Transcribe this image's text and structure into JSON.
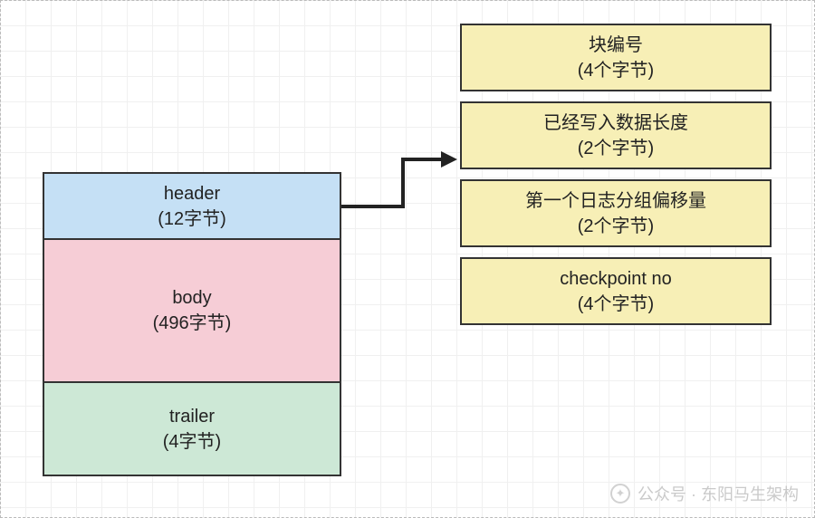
{
  "left_stack": {
    "header": {
      "label": "header",
      "sub": "(12字节)"
    },
    "body": {
      "label": "body",
      "sub": "(496字节)"
    },
    "trailer": {
      "label": "trailer",
      "sub": "(4字节)"
    }
  },
  "right_stack": {
    "block_no": {
      "label": "块编号",
      "sub": "(4个字节)"
    },
    "data_len": {
      "label": "已经写入数据长度",
      "sub": "(2个字节)"
    },
    "offset": {
      "label": "第一个日志分组偏移量",
      "sub": "(2个字节)"
    },
    "checkpoint": {
      "label": "checkpoint no",
      "sub": "(4个字节)"
    }
  },
  "watermark": {
    "text": "公众号 · 东阳马生架构"
  }
}
